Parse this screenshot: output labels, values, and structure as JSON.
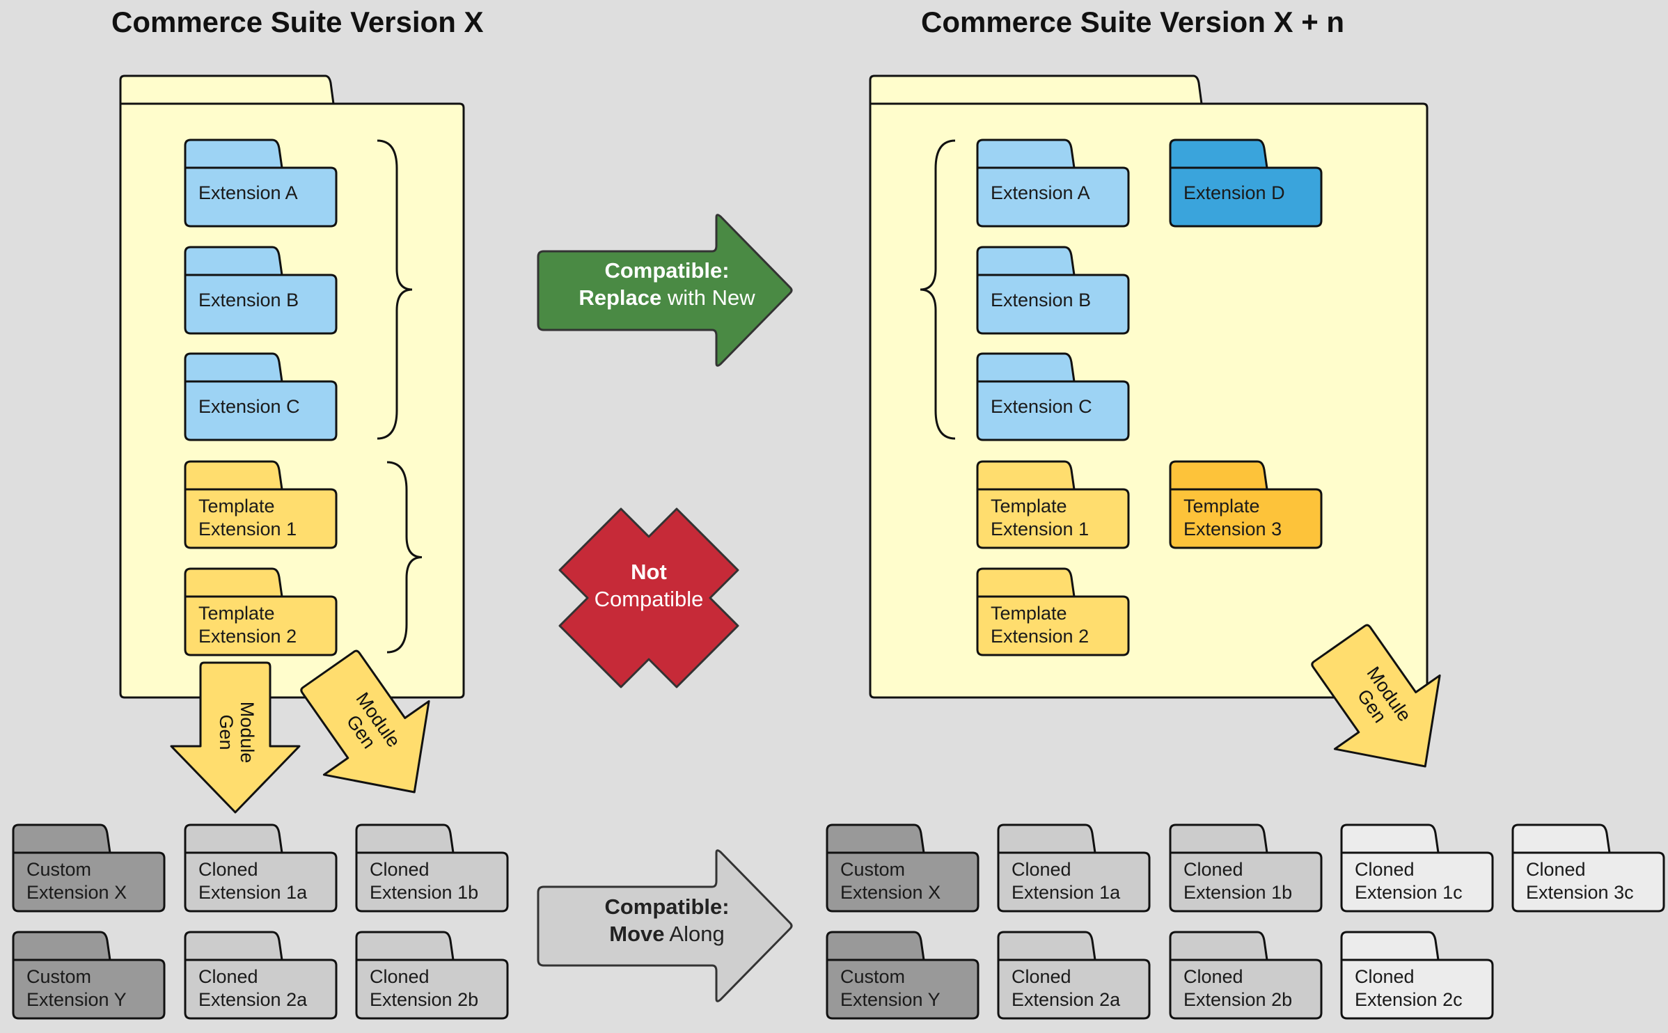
{
  "titles": {
    "left": "Commerce Suite Version X",
    "right": "Commerce Suite Version X + n"
  },
  "colors": {
    "background": "#dedede",
    "suite_folder": "#fffdcc",
    "extension_blue": "#9dd3f4",
    "extension_new_blue": "#3aa4dc",
    "template_yellow": "#ffdd6e",
    "template_new_yellow": "#fdc33a",
    "custom_gray": "#999999",
    "cloned_gray": "#cccccc",
    "cloned_new_gray": "#ececec",
    "compatible_green": "#4a8a44",
    "not_compatible_red": "#c62a38",
    "move_along_gray": "#cfcfcf",
    "module_gen_yellow": "#ffdd6e"
  },
  "left_suite": {
    "extensions": [
      {
        "label": [
          "Extension A"
        ],
        "kind": "extension"
      },
      {
        "label": [
          "Extension B"
        ],
        "kind": "extension"
      },
      {
        "label": [
          "Extension C"
        ],
        "kind": "extension"
      },
      {
        "label": [
          "Template",
          "Extension 1"
        ],
        "kind": "template"
      },
      {
        "label": [
          "Template",
          "Extension 2"
        ],
        "kind": "template"
      }
    ]
  },
  "right_suite": {
    "extensions": [
      {
        "label": [
          "Extension A"
        ],
        "kind": "extension"
      },
      {
        "label": [
          "Extension D"
        ],
        "kind": "extension_new"
      },
      {
        "label": [
          "Extension B"
        ],
        "kind": "extension"
      },
      {
        "label": [
          "Extension C"
        ],
        "kind": "extension"
      },
      {
        "label": [
          "Template",
          "Extension 1"
        ],
        "kind": "template"
      },
      {
        "label": [
          "Template",
          "Extension 3"
        ],
        "kind": "template_new"
      },
      {
        "label": [
          "Template",
          "Extension 2"
        ],
        "kind": "template"
      }
    ]
  },
  "left_outside": [
    {
      "label": [
        "Custom",
        "Extension X"
      ],
      "kind": "custom"
    },
    {
      "label": [
        "Cloned",
        "Extension 1a"
      ],
      "kind": "cloned"
    },
    {
      "label": [
        "Cloned",
        "Extension 1b"
      ],
      "kind": "cloned"
    },
    {
      "label": [
        "Custom",
        "Extension Y"
      ],
      "kind": "custom"
    },
    {
      "label": [
        "Cloned",
        "Extension 2a"
      ],
      "kind": "cloned"
    },
    {
      "label": [
        "Cloned",
        "Extension 2b"
      ],
      "kind": "cloned"
    }
  ],
  "right_outside": [
    {
      "label": [
        "Custom",
        "Extension X"
      ],
      "kind": "custom"
    },
    {
      "label": [
        "Cloned",
        "Extension 1a"
      ],
      "kind": "cloned"
    },
    {
      "label": [
        "Cloned",
        "Extension 1b"
      ],
      "kind": "cloned"
    },
    {
      "label": [
        "Cloned",
        "Extension 1c"
      ],
      "kind": "cloned_new"
    },
    {
      "label": [
        "Cloned",
        "Extension 3c"
      ],
      "kind": "cloned_new"
    },
    {
      "label": [
        "Custom",
        "Extension Y"
      ],
      "kind": "custom"
    },
    {
      "label": [
        "Cloned",
        "Extension 2a"
      ],
      "kind": "cloned"
    },
    {
      "label": [
        "Cloned",
        "Extension 2b"
      ],
      "kind": "cloned"
    },
    {
      "label": [
        "Cloned",
        "Extension 2c"
      ],
      "kind": "cloned_new"
    }
  ],
  "arrows": {
    "replace": {
      "line1_bold": "Compatible:",
      "line2_bold": "Replace",
      "line2_normal": " with New"
    },
    "not_compatible": {
      "line1_bold": "Not",
      "line2_normal": "Compatible"
    },
    "move_along": {
      "line1_bold": "Compatible:",
      "line2_bold": "Move",
      "line2_normal": " Along"
    },
    "module_gen": {
      "line1": "Module",
      "line2": "Gen"
    }
  }
}
